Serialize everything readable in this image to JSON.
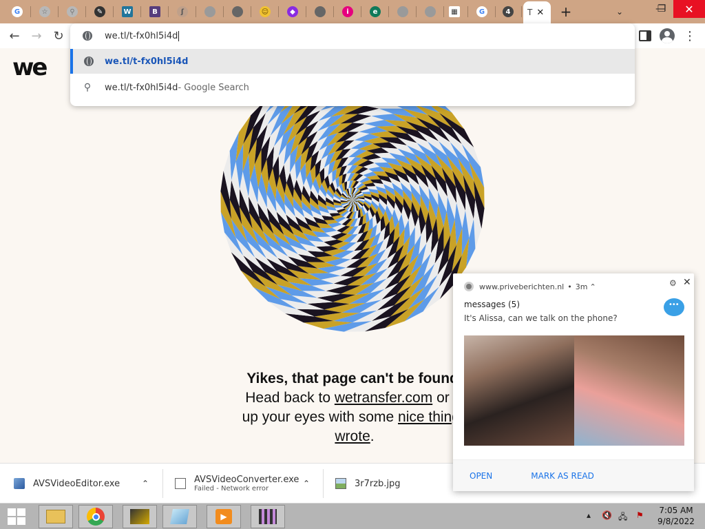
{
  "tabs": [
    {
      "icon": "google-icon",
      "bg": "#ffffff",
      "glyph": "G",
      "color": "#4285f4"
    },
    {
      "icon": "star-icon",
      "bg": "#b8b8b8",
      "glyph": "☆",
      "color": "#666"
    },
    {
      "icon": "search-site-icon",
      "bg": "#b8b8b8",
      "glyph": "⚲",
      "color": "#777"
    },
    {
      "icon": "feather-icon",
      "bg": "#333333",
      "glyph": "✎",
      "color": "#fff"
    },
    {
      "icon": "wordpress-icon",
      "bg": "#21759b",
      "glyph": "W",
      "color": "#fff"
    },
    {
      "icon": "bootstrap-icon",
      "bg": "#563d7c",
      "glyph": "B",
      "color": "#fff"
    },
    {
      "icon": "hook-icon",
      "bg": "#bfa08a",
      "glyph": "ʃ",
      "color": "#555"
    },
    {
      "icon": "grey-site-icon",
      "bg": "#9a9a9a",
      "glyph": "",
      "color": "#fff"
    },
    {
      "icon": "globe-icon",
      "bg": "#666666",
      "glyph": "",
      "color": "#fff"
    },
    {
      "icon": "emoji-icon",
      "bg": "#f1c232",
      "glyph": "☺",
      "color": "#6b4e00"
    },
    {
      "icon": "diamond-icon",
      "bg": "#8a2be2",
      "glyph": "◆",
      "color": "#fff"
    },
    {
      "icon": "globe-icon",
      "bg": "#666666",
      "glyph": "",
      "color": "#fff"
    },
    {
      "icon": "info-icon",
      "bg": "#e6007e",
      "glyph": "i",
      "color": "#fff"
    },
    {
      "icon": "teal-circle-icon",
      "bg": "#0f7a5a",
      "glyph": "e",
      "color": "#fff"
    },
    {
      "icon": "grey-site-icon",
      "bg": "#9a9a9a",
      "glyph": "",
      "color": "#fff"
    },
    {
      "icon": "grey-site-icon",
      "bg": "#9a9a9a",
      "glyph": "",
      "color": "#fff"
    },
    {
      "icon": "table-icon",
      "bg": "#ffffff",
      "glyph": "▦",
      "color": "#333"
    },
    {
      "icon": "google-icon",
      "bg": "#ffffff",
      "glyph": "G",
      "color": "#4285f4"
    },
    {
      "icon": "badge-4-icon",
      "bg": "#444444",
      "glyph": "4",
      "color": "#fff"
    }
  ],
  "active_tab": {
    "label": "T",
    "close": "✕"
  },
  "new_tab": "+",
  "window": {
    "minimize": "—",
    "restore": "❐",
    "close": "✕"
  },
  "omnibox": {
    "input": "we.tl/t-fx0hl5i4d",
    "suggestions": [
      {
        "text": "we.tl/t-fx0hl5i4d",
        "suffix": ""
      },
      {
        "text": "we.tl/t-fx0hl5i4d",
        "suffix": " - Google Search"
      }
    ]
  },
  "page": {
    "logo": "we",
    "title": "Yikes, that page can't be found.",
    "line2_pre": "Head back to ",
    "line2_link": "wetransfer.com",
    "line2_post": " or cl",
    "line3_pre": "up your eyes with some ",
    "line3_link": "nice things",
    "line4_link": "wrote",
    "line4_post": "."
  },
  "downloads": [
    {
      "name": "AVSVideoEditor.exe",
      "status": ""
    },
    {
      "name": "AVSVideoConverter.exe",
      "status": "Failed - Network error"
    },
    {
      "name": "3r7rzb.jpg",
      "status": ""
    }
  ],
  "notification": {
    "source": "www.priveberichten.nl",
    "time": "3m",
    "title": "messages (5)",
    "body": "It's Alissa, can we talk on the phone?",
    "open": "OPEN",
    "mark_read": "MARK AS READ"
  },
  "taskbar": {
    "apps": [
      "file-explorer-icon",
      "chrome-icon",
      "avs-editor-icon",
      "notepad-icon",
      "media-player-icon",
      "video-editor-icon"
    ],
    "time": "7:05 AM",
    "date": "9/8/2022"
  },
  "spiral_colors": [
    "#c9a227",
    "#1a1320",
    "#ececec",
    "#5e9be8"
  ]
}
